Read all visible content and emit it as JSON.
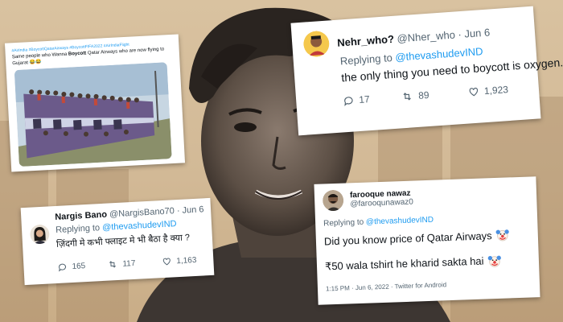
{
  "tweet_photo": {
    "hashtags": "#AirIndia #BoycottQatarAirways #BoycottFIFA2022 #AirIndiaFlight",
    "text_before": "Same people who Wanna ",
    "text_bold": "Boycott",
    "text_after": " Qatar Airways who are now flying to Gujarat 😂😂"
  },
  "tweet_nehr": {
    "name": "Nehr_who?",
    "handle": "@Nher_who",
    "date": "· Jun 6",
    "replying_prefix": "Replying to ",
    "replying_handle": "@thevashudevIND",
    "text": "the only thing you need to boycott is oxygen.",
    "replies": "17",
    "retweets": "89",
    "likes": "1,923"
  },
  "tweet_nargis": {
    "name": "Nargis Bano",
    "handle": "@NargisBano70",
    "date": "· Jun 6",
    "replying_prefix": "Replying to ",
    "replying_handle": "@thevashudevIND",
    "text": "ज़िंदगी मे कभी फ्लाइट मे भी बैठा है क्या ?",
    "replies": "165",
    "retweets": "117",
    "likes": "1,163"
  },
  "tweet_farooque": {
    "name": "farooque nawaz",
    "handle": "@farooqunawaz0",
    "replying_prefix": "Replying to ",
    "replying_handle": "@thevashudevIND",
    "line1": "Did you know price of Qatar Airways",
    "line2": "₹50  wala tshirt he kharid sakta hai",
    "footer": "1:15 PM · Jun 6, 2022 · Twitter for Android"
  },
  "colors": {
    "twitter_blue": "#1d9bf0",
    "sepia_bg": "#d2b996"
  },
  "icons": [
    "reply-icon",
    "retweet-icon",
    "like-icon",
    "clown-emoji-icon"
  ]
}
